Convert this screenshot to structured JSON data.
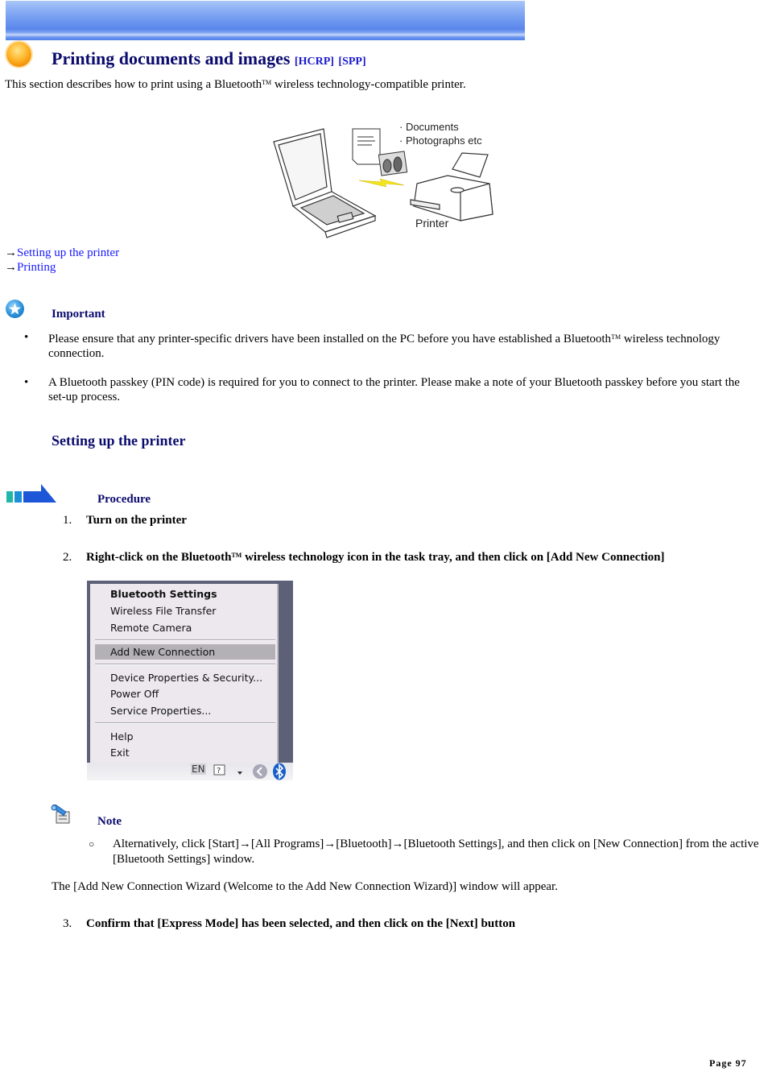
{
  "header": {
    "title": "Printing documents and images",
    "tag_hcrp": "[HCRP]",
    "tag_spp": "[SPP]",
    "intro_before": "This section describes how to print using a Bluetooth",
    "tm": "TM",
    "intro_after": " wireless technology-compatible printer."
  },
  "illustration": {
    "caption_documents": "· Documents",
    "caption_photos": "· Photographs etc",
    "caption_printer": "Printer"
  },
  "links": {
    "arrow": "→",
    "setup": "Setting up the printer",
    "printing": "Printing"
  },
  "important": {
    "heading": "Important",
    "items": [
      {
        "before": "Please ensure that any printer-specific drivers have been installed on the PC before you have established a Bluetooth",
        "tm": "TM",
        "after": " wireless technology connection."
      },
      {
        "before": "A Bluetooth passkey (PIN code) is required for you to connect to the printer. Please make a note of your Bluetooth passkey before you start the set-up process.",
        "tm": "",
        "after": ""
      }
    ]
  },
  "section": {
    "heading": "Setting up the printer",
    "procedure_label": "Procedure",
    "steps": [
      {
        "num": "1.",
        "text": "Turn on the printer"
      },
      {
        "num": "2.",
        "before": "Right-click on the Bluetooth",
        "tm": "TM",
        "after": " wireless technology icon in the task tray, and then click on [Add New Connection]"
      },
      {
        "num": "3.",
        "text": "Confirm that [Express Mode] has been selected, and then click on the [Next] button"
      }
    ]
  },
  "context_menu": {
    "items": [
      "Bluetooth Settings",
      "Wireless File Transfer",
      "Remote Camera",
      "Add New Connection",
      "Device Properties & Security...",
      "Power Off",
      "Service Properties...",
      "Help",
      "Exit"
    ],
    "highlighted": "Add New Connection",
    "taskbar_lang": "EN"
  },
  "note": {
    "heading": "Note",
    "items": [
      "Alternatively, click [Start]→[All Programs]→[Bluetooth]→[Bluetooth Settings], and then click on [New Connection] from the active [Bluetooth Settings] window."
    ],
    "after_text": "The [Add New Connection Wizard (Welcome to the Add New Connection Wizard)] window will appear."
  },
  "footer": {
    "page": "Page 97"
  }
}
